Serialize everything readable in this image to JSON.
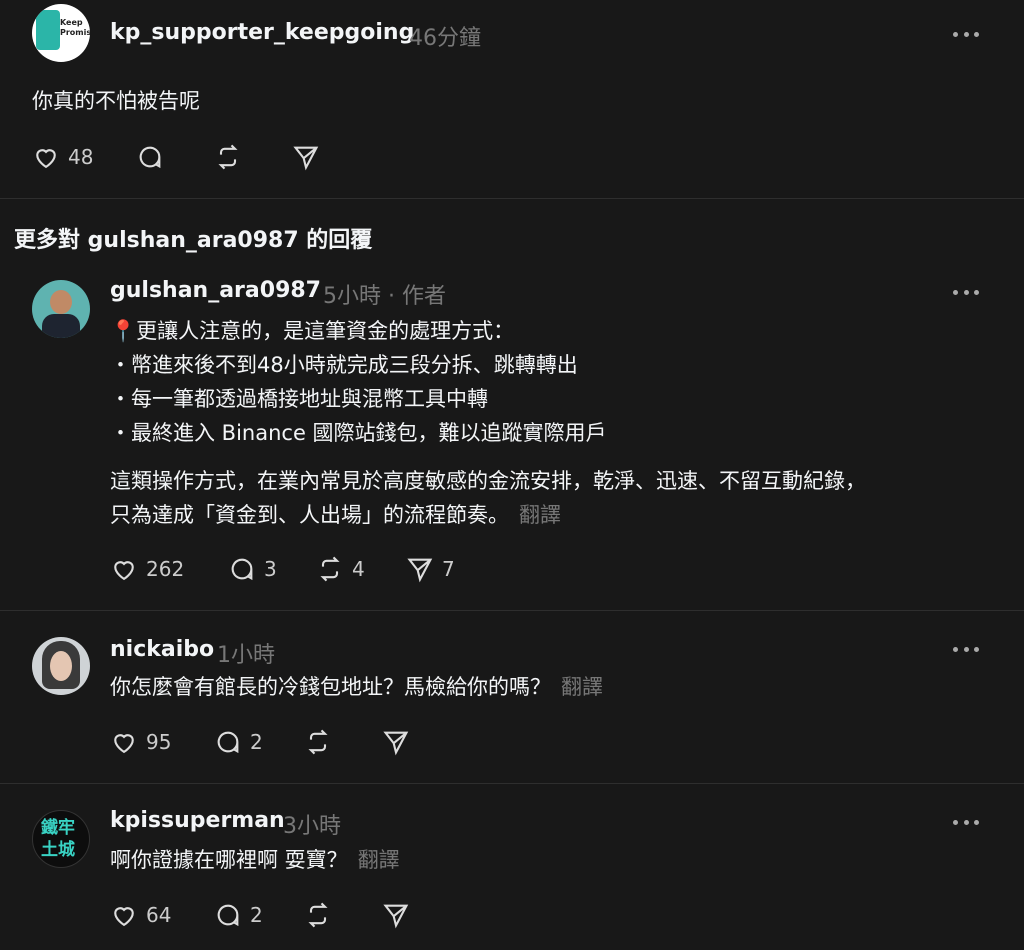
{
  "post1": {
    "username": "kp_supporter_keepgoing",
    "time": "46分鐘",
    "text": "你真的不怕被告呢",
    "likes": "48",
    "avatar_text": "Keep Promise"
  },
  "section": {
    "title": "更多對 gulshan_ara0987 的回覆"
  },
  "post2": {
    "username": "gulshan_ara0987",
    "time": "5小時 · 作者",
    "lines": [
      "📍更讓人注意的，是這筆資金的處理方式：",
      "・幣進來後不到48小時就完成三段分拆、跳轉轉出",
      "・每一筆都透過橋接地址與混幣工具中轉",
      "・最終進入 Binance 國際站錢包，難以追蹤實際用戶"
    ],
    "para2_line1": "這類操作方式，在業內常見於高度敏感的金流安排，乾淨、迅速、不留互動紀錄，",
    "para2_line2": "只為達成「資金到、人出場」的流程節奏。",
    "translate": "翻譯",
    "likes": "262",
    "replies": "3",
    "reposts": "4",
    "shares": "7"
  },
  "post3": {
    "username": "nickaibo",
    "time": "1小時",
    "text": "你怎麼會有館長的冷錢包地址？馬檢給你的嗎？",
    "translate": "翻譯",
    "likes": "95",
    "replies": "2"
  },
  "post4": {
    "username": "kpissuperman",
    "time": "3小時",
    "text": "啊你證據在哪裡啊 耍寶？",
    "translate": "翻譯",
    "likes": "64",
    "replies": "2",
    "avatar_text_1": "鐵牢",
    "avatar_text_2": "土城"
  }
}
